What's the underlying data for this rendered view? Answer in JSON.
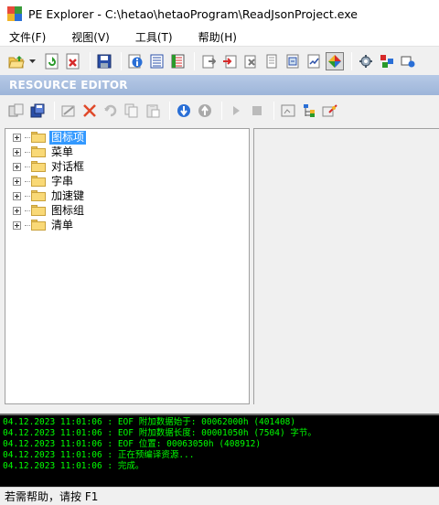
{
  "window": {
    "title": "PE Explorer - C:\\hetao\\hetaoProgram\\ReadJsonProject.exe"
  },
  "menu": {
    "items": [
      "文件(F)",
      "视图(V)",
      "工具(T)",
      "帮助(H)"
    ]
  },
  "toolbar_main": {
    "buttons": [
      "open-icon",
      "dropdown-arrow-icon",
      "refresh-icon",
      "close-file-icon",
      "save-icon",
      "info-icon",
      "headers-icon",
      "data-directories-icon",
      "section-headers-icon",
      "import-icon",
      "export-icon",
      "resources-icon",
      "debug-info-icon",
      "dependency-icon",
      "syntax-icon",
      "resource-editor-icon",
      "options-icon",
      "plugins-icon",
      "tools-icon"
    ]
  },
  "resource_editor": {
    "title": "RESOURCE EDITOR",
    "toolbar_buttons": [
      "extract-icon",
      "save-resource-icon",
      "edit-icon",
      "delete-icon",
      "undo-icon",
      "copy-icon",
      "paste-icon",
      "download-icon",
      "upload-icon",
      "play-icon",
      "stop-icon",
      "properties-icon",
      "view-tree-icon",
      "settings-icon"
    ]
  },
  "tree": {
    "items": [
      {
        "label": "图标项",
        "selected": true
      },
      {
        "label": "菜单",
        "selected": false
      },
      {
        "label": "对话框",
        "selected": false
      },
      {
        "label": "字串",
        "selected": false
      },
      {
        "label": "加速键",
        "selected": false
      },
      {
        "label": "图标组",
        "selected": false
      },
      {
        "label": "清单",
        "selected": false
      }
    ]
  },
  "log": {
    "lines": [
      "04.12.2023 11:01:06 : EOF 附加数据始于: 00062000h  (401408)",
      "04.12.2023 11:01:06 : EOF 附加数据长度: 00001050h  (7504) 字节。",
      "04.12.2023 11:01:06 : EOF 位置: 00063050h  (408912)",
      "04.12.2023 11:01:06 : 正在预编译资源...",
      "04.12.2023 11:01:06 : 完成。"
    ]
  },
  "status": {
    "text": "若需帮助，请按 F1"
  },
  "colors": {
    "selection": "#3399ff",
    "header_bar": "#9db5d9",
    "log_text": "#00ff00",
    "log_bg": "#000000"
  }
}
